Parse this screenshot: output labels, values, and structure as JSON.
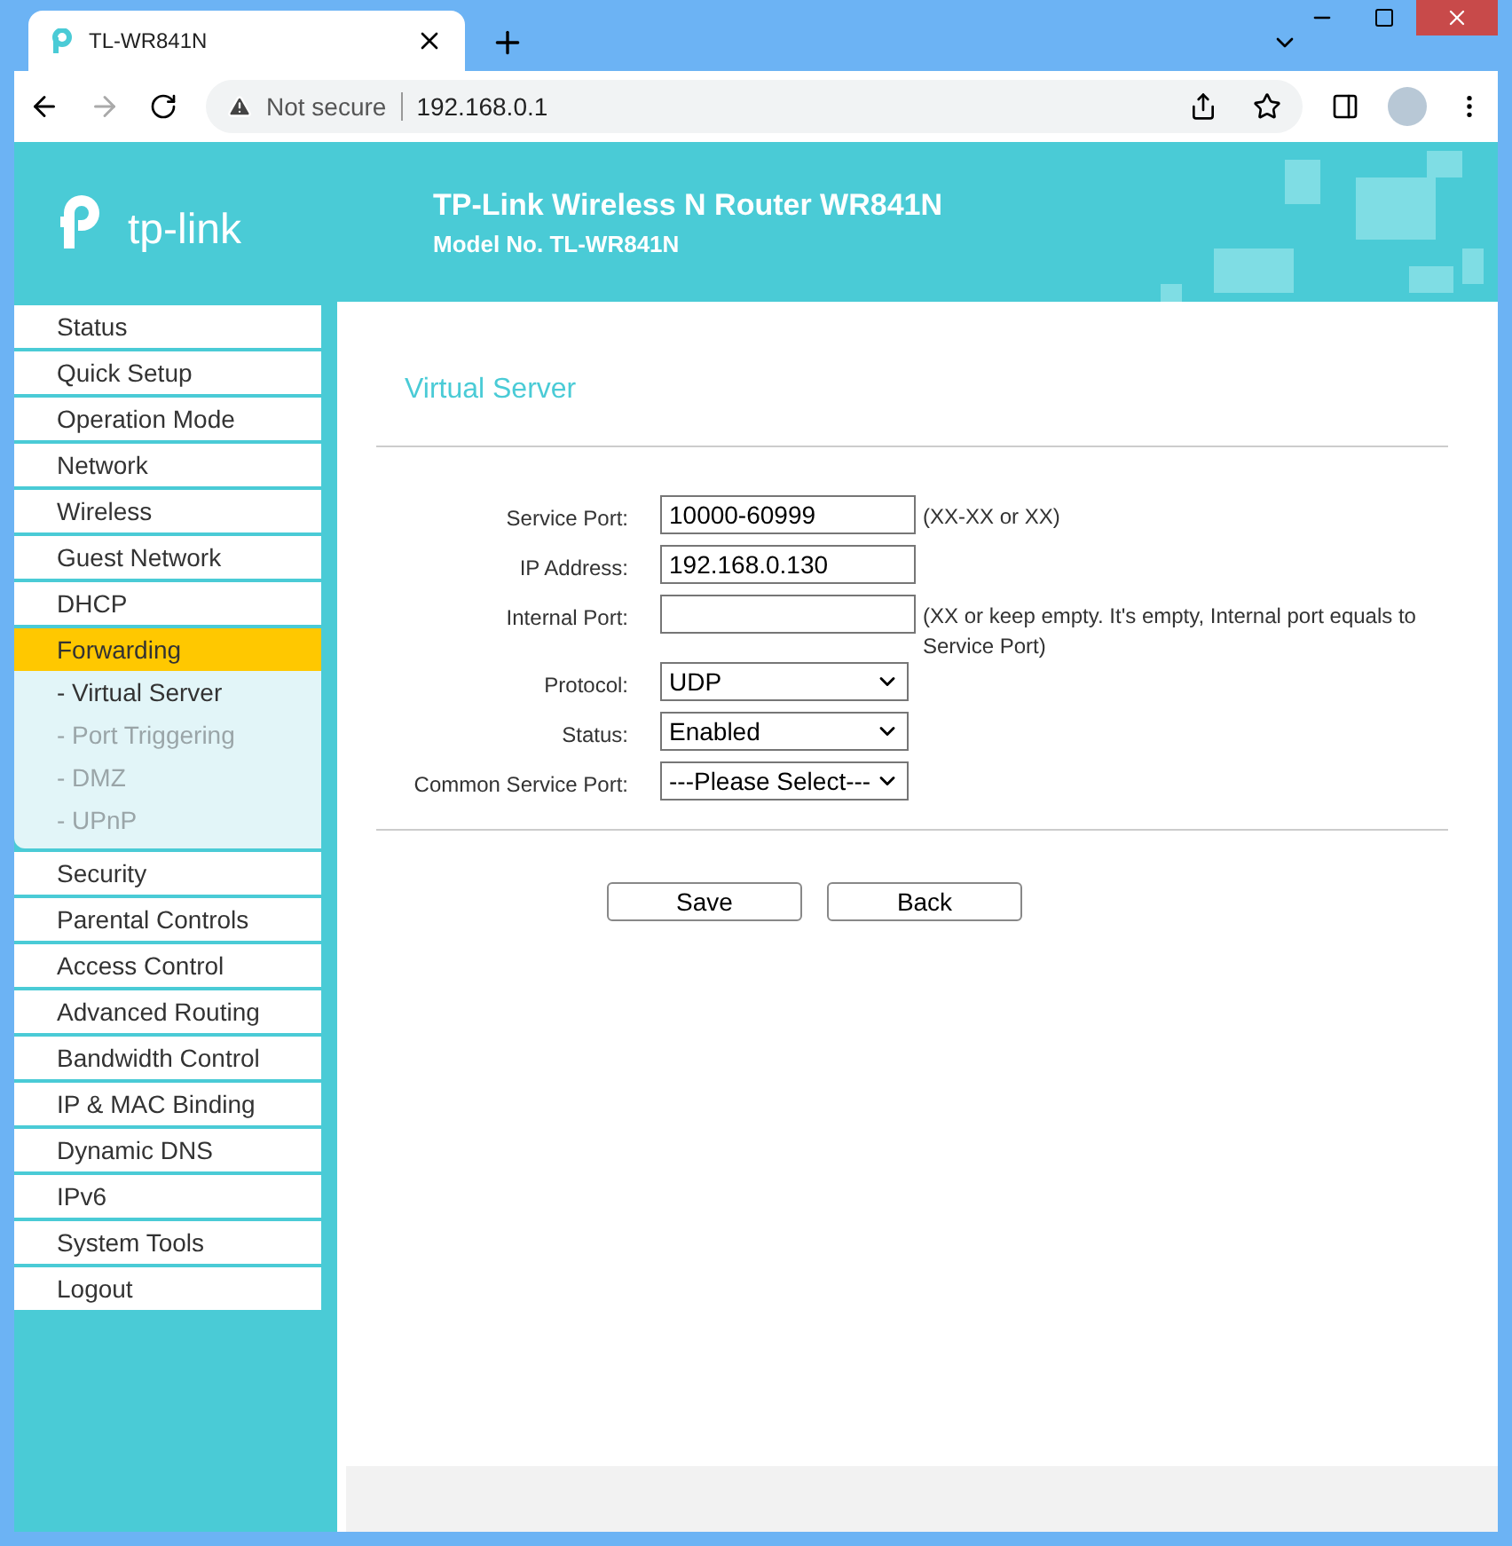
{
  "browser": {
    "tab_title": "TL-WR841N",
    "security": "Not secure",
    "url": "192.168.0.1"
  },
  "header": {
    "logo": "tp-link",
    "title": "TP-Link Wireless N Router WR841N",
    "model": "Model No. TL-WR841N"
  },
  "sidebar": {
    "items": [
      {
        "label": "Status",
        "selected": false
      },
      {
        "label": "Quick Setup",
        "selected": false
      },
      {
        "label": "Operation Mode",
        "selected": false
      },
      {
        "label": "Network",
        "selected": false
      },
      {
        "label": "Wireless",
        "selected": false
      },
      {
        "label": "Guest Network",
        "selected": false
      },
      {
        "label": "DHCP",
        "selected": false
      },
      {
        "label": "Forwarding",
        "selected": true,
        "children": [
          {
            "label": "- Virtual Server",
            "selected": true
          },
          {
            "label": "- Port Triggering",
            "selected": false
          },
          {
            "label": "- DMZ",
            "selected": false
          },
          {
            "label": "- UPnP",
            "selected": false
          }
        ]
      },
      {
        "label": "Security",
        "selected": false
      },
      {
        "label": "Parental Controls",
        "selected": false
      },
      {
        "label": "Access Control",
        "selected": false
      },
      {
        "label": "Advanced Routing",
        "selected": false
      },
      {
        "label": "Bandwidth Control",
        "selected": false
      },
      {
        "label": "IP & MAC Binding",
        "selected": false
      },
      {
        "label": "Dynamic DNS",
        "selected": false
      },
      {
        "label": "IPv6",
        "selected": false
      },
      {
        "label": "System Tools",
        "selected": false
      },
      {
        "label": "Logout",
        "selected": false
      }
    ]
  },
  "page": {
    "title": "Virtual Server",
    "fields": [
      {
        "kind": "text",
        "label": "Service Port:",
        "value": "10000-60999",
        "hint": "(XX-XX or XX)"
      },
      {
        "kind": "text",
        "label": "IP Address:",
        "value": "192.168.0.130"
      },
      {
        "kind": "text",
        "label": "Internal Port:",
        "hint": "(XX or keep empty. It's empty, Internal port equals to Service Port)"
      },
      {
        "kind": "select",
        "label": "Protocol:",
        "value": "UDP"
      },
      {
        "kind": "select",
        "label": "Status:",
        "value": "Enabled"
      },
      {
        "kind": "select",
        "label": "Common Service Port:",
        "value": "---Please Select---"
      }
    ],
    "buttons": [
      "Save",
      "Back"
    ]
  }
}
